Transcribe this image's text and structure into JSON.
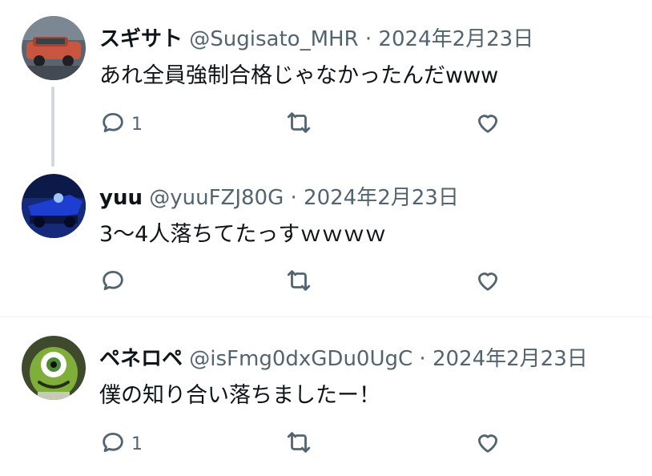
{
  "tweets": [
    {
      "name": "スギサト",
      "handle": "@Sugisato_MHR",
      "separator": "·",
      "date": "2024年2月23日",
      "text": "あれ全員強制合格じゃなかったんだwww",
      "reply_count": "1"
    },
    {
      "name": "yuu",
      "handle": "@yuuFZJ80G",
      "separator": "·",
      "date": "2024年2月23日",
      "text": "3〜4人落ちてたっすｗｗｗｗ",
      "reply_count": ""
    },
    {
      "name": "ペネロペ",
      "handle": "@isFmg0dxGDu0UgC",
      "separator": "·",
      "date": "2024年2月23日",
      "text": "僕の知り合い落ちましたー！",
      "reply_count": "1"
    }
  ],
  "icons": [
    "reply-icon",
    "retweet-icon",
    "like-icon"
  ],
  "colors": {
    "secondary_text": "#536471",
    "primary_text": "#0f1419",
    "thread_line": "#cfd9de"
  }
}
